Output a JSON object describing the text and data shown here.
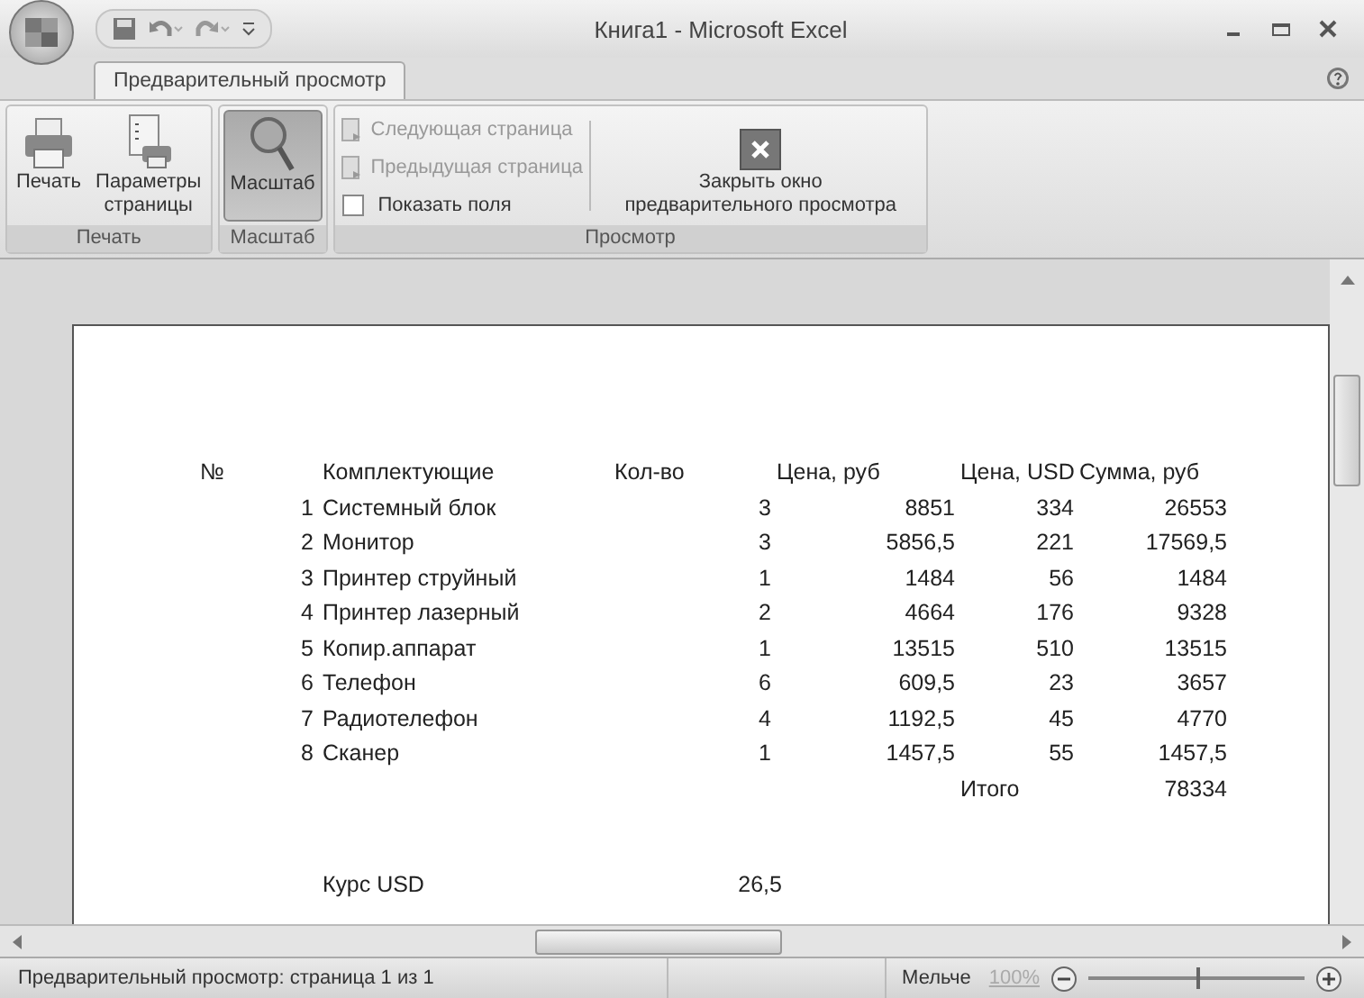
{
  "window": {
    "title": "Книга1 - Microsoft Excel"
  },
  "tabs": [
    {
      "label": "Предварительный просмотр",
      "selected": true
    }
  ],
  "ribbon": {
    "groups": [
      {
        "label": "Печать",
        "buttons": [
          {
            "kind": "print",
            "label": "Печать"
          },
          {
            "kind": "page-setup",
            "label": "Параметры страницы"
          }
        ]
      },
      {
        "label": "Масштаб",
        "buttons": [
          {
            "kind": "zoom",
            "label": "Масштаб",
            "pressed": true
          }
        ]
      },
      {
        "label": "Просмотр",
        "items": [
          {
            "kind": "command",
            "label": "Следующая страница",
            "disabled": true
          },
          {
            "kind": "command",
            "label": "Предыдущая страница",
            "disabled": true
          },
          {
            "kind": "checkbox",
            "label": "Показать поля",
            "checked": false
          }
        ],
        "close_button": {
          "label": "Закрыть окно предварительного просмотра"
        }
      }
    ]
  },
  "sheet": {
    "columns": [
      "№",
      "Комплектующие",
      "Кол-во",
      "Цена, руб",
      "Цена, USD",
      "Сумма, руб"
    ],
    "rows": [
      [
        "1",
        "Системный блок",
        "3",
        "8851",
        "334",
        "26553"
      ],
      [
        "2",
        "Монитор",
        "3",
        "5856,5",
        "221",
        "17569,5"
      ],
      [
        "3",
        "Принтер струйный",
        "1",
        "1484",
        "56",
        "1484"
      ],
      [
        "4",
        "Принтер лазерный",
        "2",
        "4664",
        "176",
        "9328"
      ],
      [
        "5",
        "Копир.аппарат",
        "1",
        "13515",
        "510",
        "13515"
      ],
      [
        "6",
        "Телефон",
        "6",
        "609,5",
        "23",
        "3657"
      ],
      [
        "7",
        "Радиотелефон",
        "4",
        "1192,5",
        "45",
        "4770"
      ],
      [
        "8",
        "Сканер",
        "1",
        "1457,5",
        "55",
        "1457,5"
      ]
    ],
    "total": {
      "label": "Итого",
      "value": "78334"
    },
    "rate": {
      "label": "Курс USD",
      "value": "26,5"
    }
  },
  "status_bar": {
    "text": "Предварительный просмотр: страница 1 из 1",
    "zoom_out": "Мельче",
    "zoom": {
      "label": "100%",
      "disabled": true,
      "level": 0.5
    }
  }
}
